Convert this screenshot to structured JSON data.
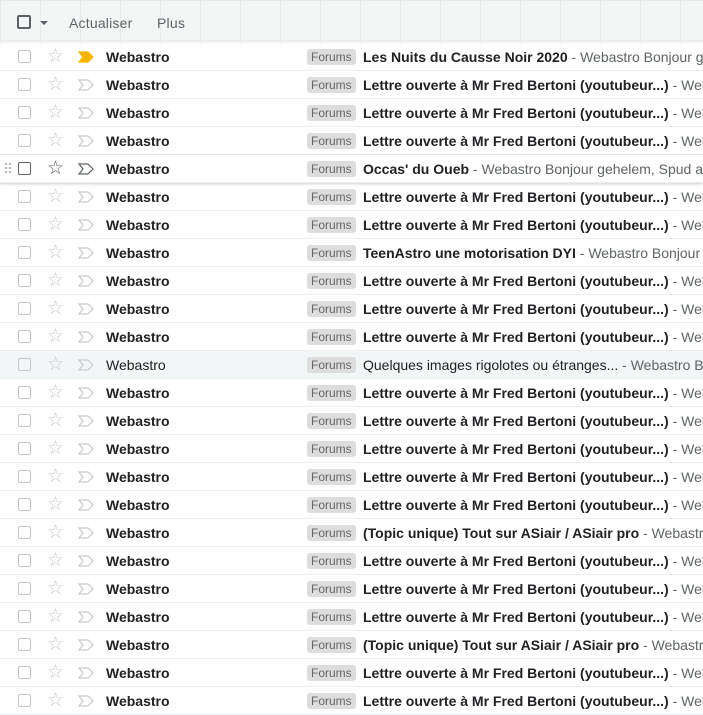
{
  "toolbar": {
    "refresh_label": "Actualiser",
    "more_label": "Plus"
  },
  "emails": [
    {
      "sender": "Webastro",
      "label": "Forums",
      "subject": "Les Nuits du Causse Noir 2020",
      "snippet": " - Webastro Bonjour ge",
      "important": true,
      "read": false,
      "hover": false
    },
    {
      "sender": "Webastro",
      "label": "Forums",
      "subject": "Lettre ouverte à Mr Fred Bertoni (youtubeur...)",
      "snippet": " - Web",
      "important": false,
      "read": false,
      "hover": false
    },
    {
      "sender": "Webastro",
      "label": "Forums",
      "subject": "Lettre ouverte à Mr Fred Bertoni (youtubeur...)",
      "snippet": " - Web",
      "important": false,
      "read": false,
      "hover": false
    },
    {
      "sender": "Webastro",
      "label": "Forums",
      "subject": "Lettre ouverte à Mr Fred Bertoni (youtubeur...)",
      "snippet": " - Web",
      "important": false,
      "read": false,
      "hover": false
    },
    {
      "sender": "Webastro",
      "label": "Forums",
      "subject": "Occas' du Oueb",
      "snippet": " - Webastro Bonjour gehelem, Spud a",
      "important": false,
      "read": false,
      "hover": true
    },
    {
      "sender": "Webastro",
      "label": "Forums",
      "subject": "Lettre ouverte à Mr Fred Bertoni (youtubeur...)",
      "snippet": " - Web",
      "important": false,
      "read": false,
      "hover": false
    },
    {
      "sender": "Webastro",
      "label": "Forums",
      "subject": "Lettre ouverte à Mr Fred Bertoni (youtubeur...)",
      "snippet": " - Web",
      "important": false,
      "read": false,
      "hover": false
    },
    {
      "sender": "Webastro",
      "label": "Forums",
      "subject": "TeenAstro une motorisation DYI",
      "snippet": " - Webastro Bonjour g",
      "important": false,
      "read": false,
      "hover": false
    },
    {
      "sender": "Webastro",
      "label": "Forums",
      "subject": "Lettre ouverte à Mr Fred Bertoni (youtubeur...)",
      "snippet": " - Web",
      "important": false,
      "read": false,
      "hover": false
    },
    {
      "sender": "Webastro",
      "label": "Forums",
      "subject": "Lettre ouverte à Mr Fred Bertoni (youtubeur...)",
      "snippet": " - Web",
      "important": false,
      "read": false,
      "hover": false
    },
    {
      "sender": "Webastro",
      "label": "Forums",
      "subject": "Lettre ouverte à Mr Fred Bertoni (youtubeur...)",
      "snippet": " - Web",
      "important": false,
      "read": false,
      "hover": false
    },
    {
      "sender": "Webastro",
      "label": "Forums",
      "subject": "Quelques images rigolotes ou étranges...",
      "snippet": " - Webastro B",
      "important": false,
      "read": true,
      "hover": false
    },
    {
      "sender": "Webastro",
      "label": "Forums",
      "subject": "Lettre ouverte à Mr Fred Bertoni (youtubeur...)",
      "snippet": " - Web",
      "important": false,
      "read": false,
      "hover": false
    },
    {
      "sender": "Webastro",
      "label": "Forums",
      "subject": "Lettre ouverte à Mr Fred Bertoni (youtubeur...)",
      "snippet": " - Web",
      "important": false,
      "read": false,
      "hover": false
    },
    {
      "sender": "Webastro",
      "label": "Forums",
      "subject": "Lettre ouverte à Mr Fred Bertoni (youtubeur...)",
      "snippet": " - Web",
      "important": false,
      "read": false,
      "hover": false
    },
    {
      "sender": "Webastro",
      "label": "Forums",
      "subject": "Lettre ouverte à Mr Fred Bertoni (youtubeur...)",
      "snippet": " - Web",
      "important": false,
      "read": false,
      "hover": false
    },
    {
      "sender": "Webastro",
      "label": "Forums",
      "subject": "Lettre ouverte à Mr Fred Bertoni (youtubeur...)",
      "snippet": " - Web",
      "important": false,
      "read": false,
      "hover": false
    },
    {
      "sender": "Webastro",
      "label": "Forums",
      "subject": "(Topic unique) Tout sur ASiair / ASiair pro",
      "snippet": " - Webastro",
      "important": false,
      "read": false,
      "hover": false
    },
    {
      "sender": "Webastro",
      "label": "Forums",
      "subject": "Lettre ouverte à Mr Fred Bertoni (youtubeur...)",
      "snippet": " - Web",
      "important": false,
      "read": false,
      "hover": false
    },
    {
      "sender": "Webastro",
      "label": "Forums",
      "subject": "Lettre ouverte à Mr Fred Bertoni (youtubeur...)",
      "snippet": " - Web",
      "important": false,
      "read": false,
      "hover": false
    },
    {
      "sender": "Webastro",
      "label": "Forums",
      "subject": "Lettre ouverte à Mr Fred Bertoni (youtubeur...)",
      "snippet": " - Web",
      "important": false,
      "read": false,
      "hover": false
    },
    {
      "sender": "Webastro",
      "label": "Forums",
      "subject": "(Topic unique) Tout sur ASiair / ASiair pro",
      "snippet": " - Webastro",
      "important": false,
      "read": false,
      "hover": false
    },
    {
      "sender": "Webastro",
      "label": "Forums",
      "subject": "Lettre ouverte à Mr Fred Bertoni (youtubeur...)",
      "snippet": " - Web",
      "important": false,
      "read": false,
      "hover": false
    },
    {
      "sender": "Webastro",
      "label": "Forums",
      "subject": "Lettre ouverte à Mr Fred Bertoni (youtubeur...)",
      "snippet": " - Web",
      "important": false,
      "read": false,
      "hover": false
    }
  ],
  "colors": {
    "important_marker": "#f4b400",
    "label_bg": "#dddddd",
    "read_row_bg": "#f2f6f7"
  }
}
